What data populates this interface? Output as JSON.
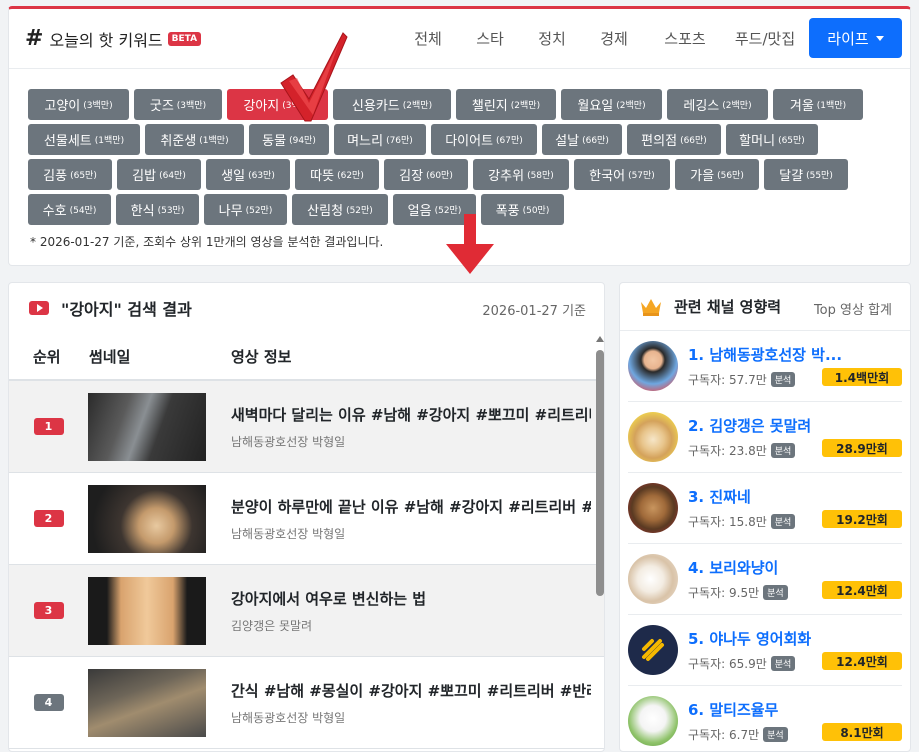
{
  "header": {
    "hash": "#",
    "title": "오늘의 핫 키워드",
    "beta": "BETA",
    "categories": [
      "전체",
      "스타",
      "정치",
      "경제",
      "스포츠",
      "푸드/맛집"
    ],
    "active_category": "라이프"
  },
  "keywords": [
    [
      {
        "word": "고양이",
        "count": "(3백만)"
      },
      {
        "word": "굿즈",
        "count": "(3백만)"
      },
      {
        "word": "강아지",
        "count": "(3백만)",
        "active": true
      },
      {
        "word": "신용카드",
        "count": "(2백만)"
      },
      {
        "word": "챌린지",
        "count": "(2백만)"
      },
      {
        "word": "월요일",
        "count": "(2백만)"
      },
      {
        "word": "레깅스",
        "count": "(2백만)"
      },
      {
        "word": "겨울",
        "count": "(1백만)"
      }
    ],
    [
      {
        "word": "선물세트",
        "count": "(1백만)"
      },
      {
        "word": "취준생",
        "count": "(1백만)"
      },
      {
        "word": "동물",
        "count": "(94만)"
      },
      {
        "word": "며느리",
        "count": "(76만)"
      },
      {
        "word": "다이어트",
        "count": "(67만)"
      },
      {
        "word": "설날",
        "count": "(66만)"
      },
      {
        "word": "편의점",
        "count": "(66만)"
      },
      {
        "word": "할머니",
        "count": "(65만)"
      }
    ],
    [
      {
        "word": "김풍",
        "count": "(65만)"
      },
      {
        "word": "김밥",
        "count": "(64만)"
      },
      {
        "word": "생일",
        "count": "(63만)"
      },
      {
        "word": "따뜻",
        "count": "(62만)"
      },
      {
        "word": "김장",
        "count": "(60만)"
      },
      {
        "word": "강추위",
        "count": "(58만)"
      },
      {
        "word": "한국어",
        "count": "(57만)"
      },
      {
        "word": "가을",
        "count": "(56만)"
      },
      {
        "word": "달걀",
        "count": "(55만)"
      }
    ],
    [
      {
        "word": "수호",
        "count": "(54만)"
      },
      {
        "word": "한식",
        "count": "(53만)"
      },
      {
        "word": "나무",
        "count": "(52만)"
      },
      {
        "word": "산림청",
        "count": "(52만)"
      },
      {
        "word": "얼음",
        "count": "(52만)"
      },
      {
        "word": "폭풍",
        "count": "(50만)"
      }
    ]
  ],
  "note": "* 2026-01-27 기준, 조회수 상위 1만개의 영상을 분석한 결과입니다.",
  "results": {
    "title": "\"강아지\" 검색 결과",
    "date": "2026-01-27 기준",
    "col_rank": "순위",
    "col_thumb": "썸네일",
    "col_info": "영상 정보",
    "rows": [
      {
        "rank": "1",
        "title": "새벽마다 달리는 이유 #남해 #강아지 #뽀끄미 #리트리버",
        "channel": "남해동광호선장 박형일"
      },
      {
        "rank": "2",
        "title": "분양이 하루만에 끝난 이유 #남해 #강아지 #리트리버 #",
        "channel": "남해동광호선장 박형일"
      },
      {
        "rank": "3",
        "title": "강아지에서 여우로 변신하는 법",
        "channel": "김양갱은 못말려"
      },
      {
        "rank": "4",
        "title": "간식 #남해 #몽실이 #강아지 #뽀끄미 #리트리버 #반려",
        "channel": "남해동광호선장 박형일"
      }
    ]
  },
  "channels": {
    "title": "관련 채널 영향력",
    "sub": "Top 영상 합계",
    "subs_label": "구독자:",
    "tag": "분석",
    "items": [
      {
        "name": "1. 남해동광호선장 박...",
        "subs": "57.7만",
        "views": "1.4백만회"
      },
      {
        "name": "2. 김양갱은 못말려",
        "subs": "23.8만",
        "views": "28.9만회"
      },
      {
        "name": "3. 진짜네",
        "subs": "15.8만",
        "views": "19.2만회"
      },
      {
        "name": "4. 보리와냥이",
        "subs": "9.5만",
        "views": "12.4만회"
      },
      {
        "name": "5. 야나두 영어회화",
        "subs": "65.9만",
        "views": "12.4만회"
      },
      {
        "name": "6. 말티즈율무",
        "subs": "6.7만",
        "views": "8.1만회"
      }
    ]
  },
  "colors": {
    "accent_red": "#dc3545",
    "primary_blue": "#0d6efd",
    "badge_gray": "#6c757d",
    "views_yellow": "#ffc107"
  }
}
